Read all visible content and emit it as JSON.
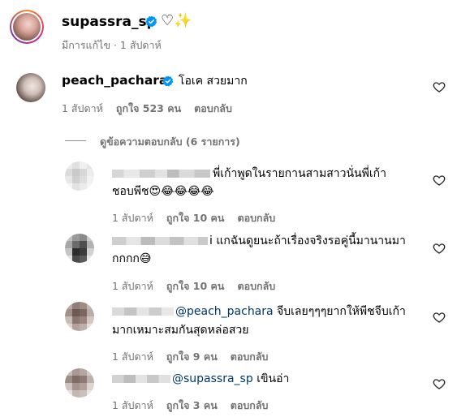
{
  "caption": {
    "username": "supassra_sp",
    "text": "♡✨",
    "meta": "มีการแก้ไข · 1 สัปดาห์"
  },
  "comment": {
    "username": "peach_pachara",
    "text": "โอเค สวยมาก",
    "time": "1 สัปดาห์",
    "likes": "ถูกใจ 523 คน",
    "reply_label": "ตอบกลับ"
  },
  "view_replies": "ดูข้อความตอบกลับ (6 รายการ)",
  "replies": [
    {
      "mention": "",
      "text_line1": "พี่เก้าพูดในรายกานสามสาวนั่นพี่เก้า",
      "text_line2": "ชอบพีช😍😂😂😂😂",
      "time": "1 สัปดาห์",
      "likes": "ถูกใจ 10 คน",
      "reply_label": "ตอบกลับ"
    },
    {
      "mention": "",
      "text_line1": "i แกฉันดูยนะถ้าเรื่องจริงรอคู่นี้มานานมา",
      "text_line2": "กกกก😅",
      "time": "1 สัปดาห์",
      "likes": "ถูกใจ 10 คน",
      "reply_label": "ตอบกลับ"
    },
    {
      "mention": "@peach_pachara",
      "text_line1": " จีบเลยๆๆๆยากให้พีชจีบเก้า",
      "text_line2": "มากเหมาะสมกันสุดหล่อสวย",
      "time": "1 สัปดาห์",
      "likes": "ถูกใจ 9 คน",
      "reply_label": "ตอบกลับ"
    },
    {
      "mention": "@supassra_sp",
      "text_line1": " เขินอ่า",
      "text_line2": "",
      "time": "1 สัปดาห์",
      "likes": "ถูกใจ 3 คน",
      "reply_label": "ตอบกลับ"
    }
  ],
  "icons": {
    "verified": "verified-badge-icon",
    "like": "heart-outline-icon"
  },
  "colors": {
    "verified": "#0095f6",
    "meta": "#737373",
    "mention": "#00376b",
    "avatar_ring": "#e1306c"
  }
}
